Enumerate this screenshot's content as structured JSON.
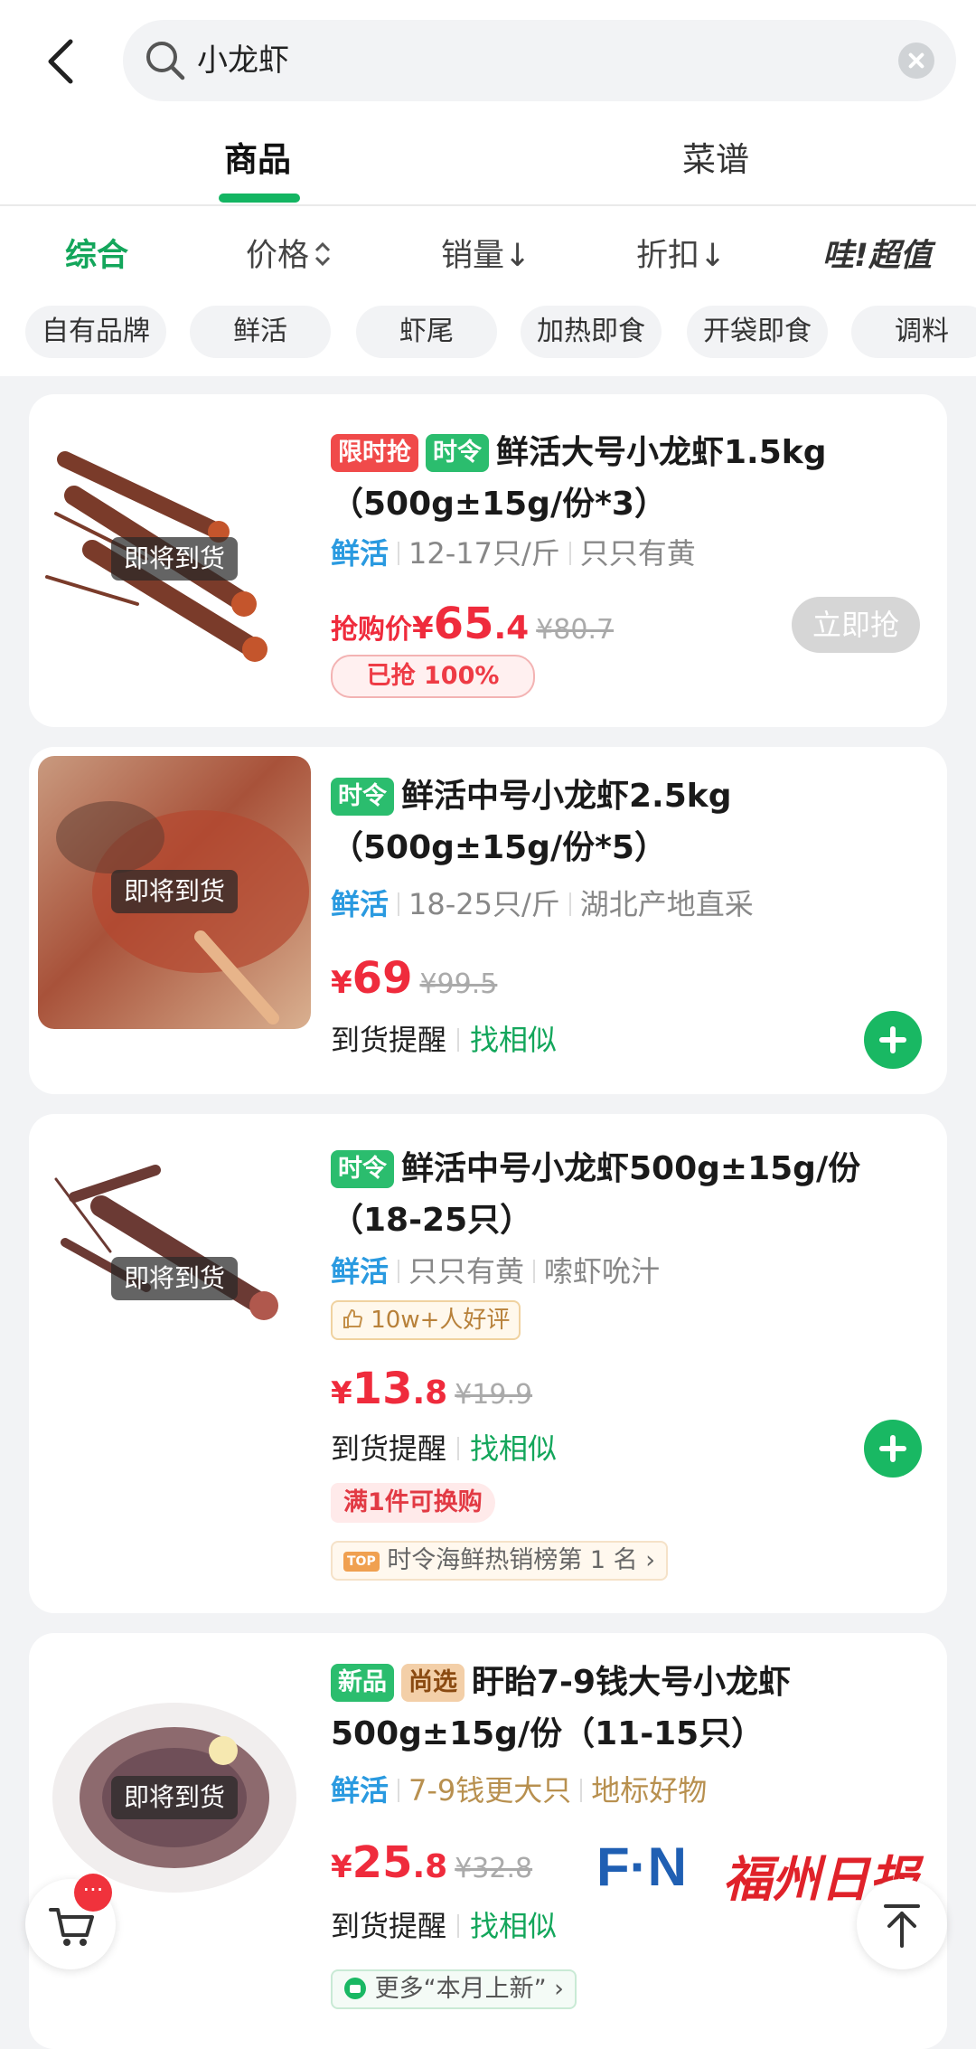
{
  "search": {
    "query": "小龙虾"
  },
  "tabs": [
    {
      "label": "商品"
    },
    {
      "label": "菜谱"
    }
  ],
  "sort": [
    {
      "label": "综合"
    },
    {
      "label": "价格"
    },
    {
      "label": "销量↓"
    },
    {
      "label": "折扣↓"
    },
    {
      "label": "哇!超值"
    }
  ],
  "chips": [
    "自有品牌",
    "鲜活",
    "虾尾",
    "加热即食",
    "开袋即食",
    "调料"
  ],
  "products": [
    {
      "overlay": "即将到货",
      "badges": [
        "限时抢",
        "时令"
      ],
      "title_line1": "鲜活大号小龙虾1.5kg",
      "title_line2": "（500g±15g/份*3）",
      "attr_fresh": "鲜活",
      "attr1": "12-17只/斤",
      "attr2": "只只有黄",
      "price_prefix": "抢购价",
      "price_sym": "¥",
      "price_int": "65",
      "price_dec": ".4",
      "orig_price": "¥80.7",
      "sold_label": "已抢 100%",
      "sold_fraction": 1.0,
      "buy_label": "立即抢"
    },
    {
      "overlay": "即将到货",
      "badges": [
        "时令"
      ],
      "title_line1": "鲜活中号小龙虾2.5kg",
      "title_line2": "（500g±15g/份*5）",
      "attr_fresh": "鲜活",
      "attr1": "18-25只/斤",
      "attr2": "湖北产地直采",
      "price_sym": "¥",
      "price_int": "69",
      "price_dec": "",
      "orig_price": "¥99.5",
      "remind": "到货提醒",
      "similar": "找相似"
    },
    {
      "overlay": "即将到货",
      "badges": [
        "时令"
      ],
      "title_line1": "鲜活中号小龙虾500g±15g/份",
      "title_line2": "（18-25只）",
      "attr_fresh": "鲜活",
      "attr1": "只只有黄",
      "attr2": "嗦虾吮汁",
      "review_tag": "10w+人好评",
      "price_sym": "¥",
      "price_int": "13",
      "price_dec": ".8",
      "orig_price": "¥19.9",
      "remind": "到货提醒",
      "similar": "找相似",
      "promo": "满1件可换购",
      "rank_badge": "TOP",
      "rank": "时令海鲜热销榜第 1 名"
    },
    {
      "overlay": "即将到货",
      "badges": [
        "新品",
        "尚选"
      ],
      "title_line1": "盱眙7-9钱大号小龙虾",
      "title_line2": "500g±15g/份（11-15只）",
      "attr_fresh": "鲜活",
      "attr1": "7-9钱更大只",
      "attr2": "地标好物",
      "price_sym": "¥",
      "price_int": "25",
      "price_dec": ".8",
      "orig_price": "¥32.8",
      "remind": "到货提醒",
      "similar": "找相似",
      "more": "更多“本月上新”"
    }
  ],
  "cart_badge": "···",
  "watermark": {
    "logo": "F·N",
    "text": "福州日报"
  },
  "colors": {
    "brand_green": "#13b562",
    "price_red": "#ef2b3c",
    "fresh_blue": "#2a9ae0"
  }
}
